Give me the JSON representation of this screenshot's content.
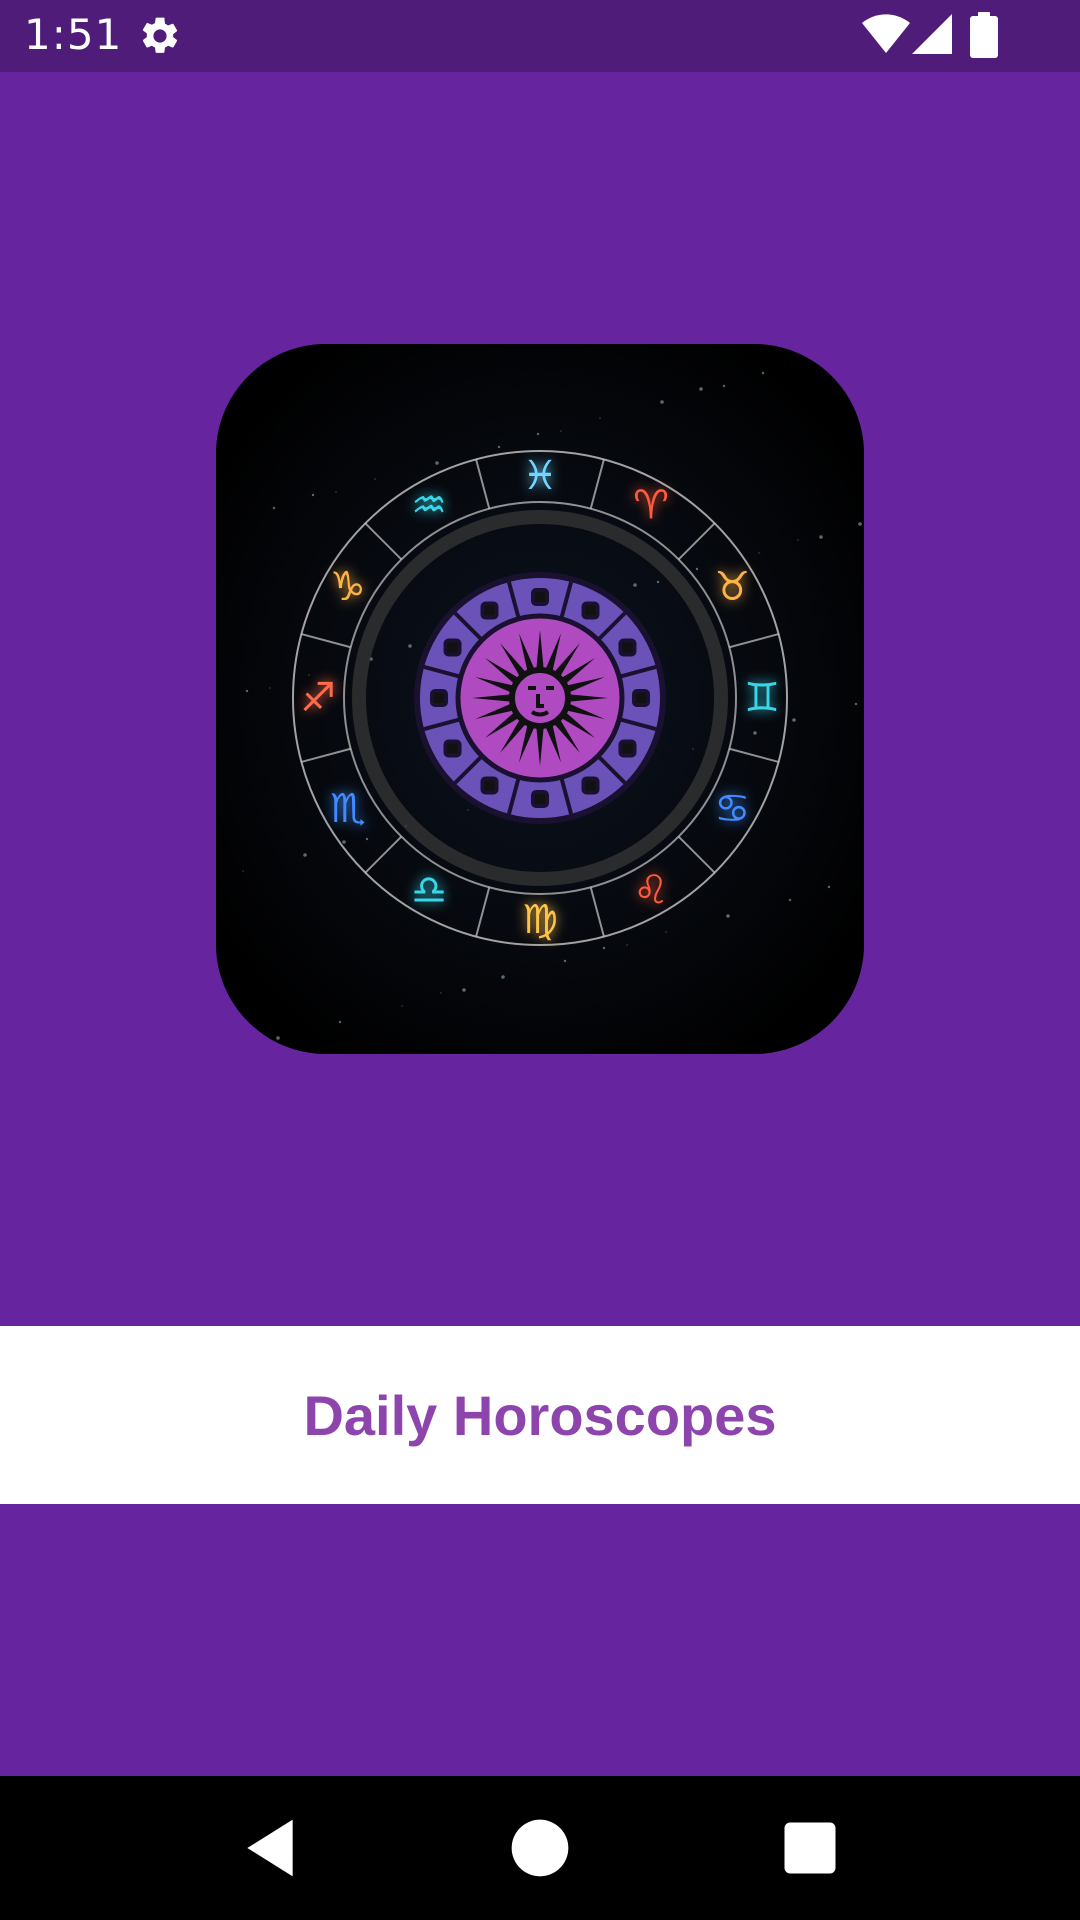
{
  "status_bar": {
    "time": "1:51",
    "icons": [
      "gear-icon",
      "wifi-icon",
      "cellular-signal-icon",
      "battery-icon"
    ]
  },
  "logo": {
    "zodiac_glyphs": [
      "♓",
      "♈",
      "♉",
      "♊",
      "♋",
      "♌",
      "♍",
      "♎",
      "♏",
      "♐",
      "♑",
      "♒"
    ],
    "glyph_colors": [
      "#6fd6ff",
      "#ff5a3a",
      "#ffb347",
      "#38d6e8",
      "#3f8cff",
      "#ff5a3a",
      "#ffc34a",
      "#38d6e8",
      "#3f8cff",
      "#ff6a4a",
      "#ffb347",
      "#38d6e8"
    ],
    "inner_ring_color": "#6a52b8",
    "center_color": "#b04ac0"
  },
  "app": {
    "title": "Daily Horoscopes",
    "background": "#67249f",
    "title_color": "#8e44ad"
  },
  "nav_bar": {
    "icons": [
      "back-icon",
      "home-icon",
      "recents-icon"
    ]
  }
}
